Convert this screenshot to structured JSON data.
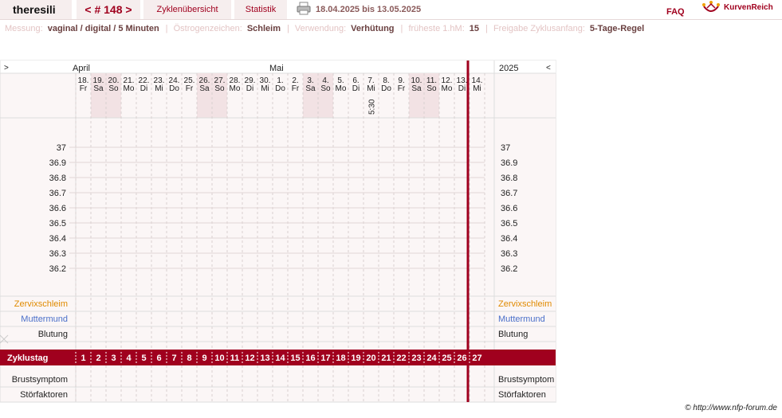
{
  "header": {
    "username": "theresili",
    "cycle_nav": "< # 148 >",
    "tab_cycles": "Zyklenübersicht",
    "tab_stats": "Statistik",
    "date_range": "18.04.2025 bis 13.05.2025",
    "faq": "FAQ",
    "logo_text": "KurvenReich"
  },
  "settings": [
    {
      "key": "Messung:",
      "value": "vaginal / digital / 5 Minuten"
    },
    {
      "key": "Östrogenzeichen:",
      "value": "Schleim"
    },
    {
      "key": "Verwendung:",
      "value": "Verhütung"
    },
    {
      "key": "früheste 1.hM:",
      "value": "15"
    },
    {
      "key": "Freigabe Zyklusanfang:",
      "value": "5-Tage-Regel"
    }
  ],
  "chart": {
    "nav_prev": ">",
    "nav_next": "<",
    "year": "2025",
    "months": [
      {
        "label": "April",
        "col": 0
      },
      {
        "label": "Mai",
        "col": 13
      }
    ],
    "days": [
      {
        "d": "18.",
        "w": "Fr",
        "we": false
      },
      {
        "d": "19.",
        "w": "Sa",
        "we": true
      },
      {
        "d": "20.",
        "w": "So",
        "we": true
      },
      {
        "d": "21.",
        "w": "Mo",
        "we": false
      },
      {
        "d": "22.",
        "w": "Di",
        "we": false
      },
      {
        "d": "23.",
        "w": "Mi",
        "we": false
      },
      {
        "d": "24.",
        "w": "Do",
        "we": false
      },
      {
        "d": "25.",
        "w": "Fr",
        "we": false
      },
      {
        "d": "26.",
        "w": "Sa",
        "we": true
      },
      {
        "d": "27.",
        "w": "So",
        "we": true
      },
      {
        "d": "28.",
        "w": "Mo",
        "we": false
      },
      {
        "d": "29.",
        "w": "Di",
        "we": false
      },
      {
        "d": "30.",
        "w": "Mi",
        "we": false
      },
      {
        "d": "1.",
        "w": "Do",
        "we": false
      },
      {
        "d": "2.",
        "w": "Fr",
        "we": false
      },
      {
        "d": "3.",
        "w": "Sa",
        "we": true
      },
      {
        "d": "4.",
        "w": "So",
        "we": true
      },
      {
        "d": "5.",
        "w": "Mo",
        "we": false
      },
      {
        "d": "6.",
        "w": "Di",
        "we": false
      },
      {
        "d": "7.",
        "w": "Mi",
        "we": false
      },
      {
        "d": "8.",
        "w": "Do",
        "we": false
      },
      {
        "d": "9.",
        "w": "Fr",
        "we": false
      },
      {
        "d": "10.",
        "w": "Sa",
        "we": true
      },
      {
        "d": "11.",
        "w": "So",
        "we": true
      },
      {
        "d": "12.",
        "w": "Mo",
        "we": false
      },
      {
        "d": "13.",
        "w": "Di",
        "we": false
      },
      {
        "d": "14.",
        "w": "Mi",
        "we": false
      }
    ],
    "time_note": {
      "col": 19,
      "text": "5:30"
    },
    "temps": [
      "37",
      "36.9",
      "36.8",
      "36.7",
      "36.6",
      "36.5",
      "36.4",
      "36.3",
      "36.2"
    ],
    "labels": {
      "cervical": "Zervixschleim",
      "mouth": "Muttermund",
      "bleeding": "Blutung",
      "cycle_day": "Zyklustag",
      "breast": "Brustsymptom",
      "disturb": "Störfaktoren"
    },
    "cycle_days": [
      "1",
      "2",
      "3",
      "4",
      "5",
      "6",
      "7",
      "8",
      "9",
      "10",
      "11",
      "12",
      "13",
      "14",
      "15",
      "16",
      "17",
      "18",
      "19",
      "20",
      "21",
      "22",
      "23",
      "24",
      "25",
      "26",
      "27"
    ],
    "today_col": 26,
    "colors": {
      "accent": "#a0001e",
      "weekend": "#f2e2e4",
      "cervical": "#e08a00",
      "mouth": "#4a6fc9"
    }
  },
  "footer": {
    "copyright": "© http://www.nfp-forum.de"
  }
}
